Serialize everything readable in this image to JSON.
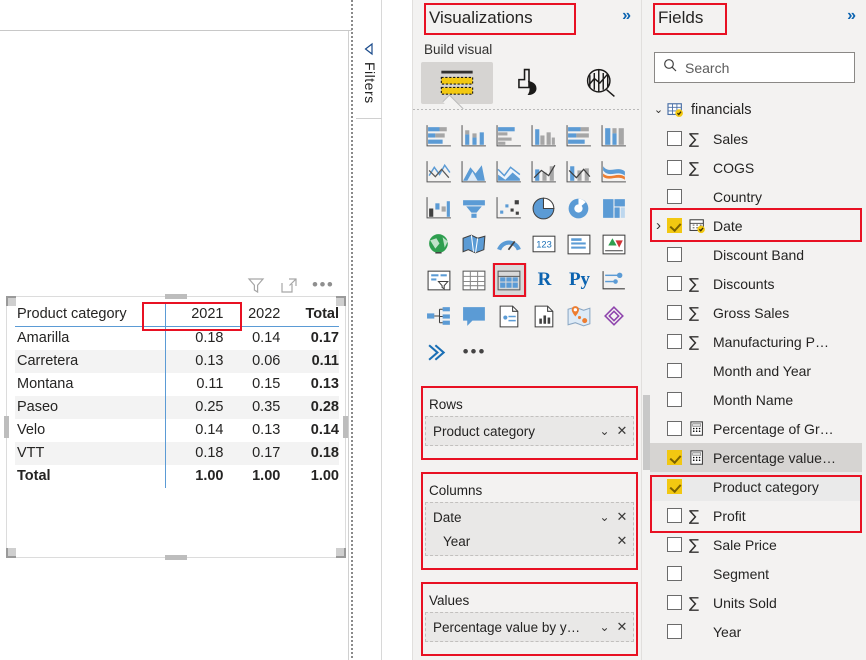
{
  "canvas": {
    "tab_chevron": "⌄",
    "filters_pane_label": "Filters"
  },
  "visual_header": {
    "filter_icon_name": "filter-icon",
    "focus_icon_name": "focus-mode-icon",
    "more_label": "•••"
  },
  "matrix": {
    "row_header": "Product category",
    "column_headers": [
      "2021",
      "2022"
    ],
    "total_header": "Total",
    "rows": [
      {
        "category": "Amarilla",
        "values": [
          "0.18",
          "0.14"
        ],
        "total": "0.17"
      },
      {
        "category": "Carretera",
        "values": [
          "0.13",
          "0.06"
        ],
        "total": "0.11"
      },
      {
        "category": "Montana",
        "values": [
          "0.11",
          "0.15"
        ],
        "total": "0.13"
      },
      {
        "category": "Paseo",
        "values": [
          "0.25",
          "0.35"
        ],
        "total": "0.28"
      },
      {
        "category": "Velo",
        "values": [
          "0.14",
          "0.13"
        ],
        "total": "0.14"
      },
      {
        "category": "VTT",
        "values": [
          "0.18",
          "0.17"
        ],
        "total": "0.18"
      }
    ],
    "total_row": {
      "category": "Total",
      "values": [
        "1.00",
        "1.00"
      ],
      "total": "1.00"
    }
  },
  "visualizations": {
    "title": "Visualizations",
    "expand_label": "»",
    "build_visual_label": "Build visual",
    "tabs": [
      {
        "name": "build-visual-tab",
        "active": true
      },
      {
        "name": "format-visual-tab",
        "active": false
      },
      {
        "name": "analytics-tab",
        "active": false
      }
    ],
    "gallery": {
      "selected": "matrix",
      "r_label": "R",
      "py_label": "Py",
      "more_label": "•••"
    },
    "wells": [
      {
        "title": "Rows",
        "name": "rows-well",
        "chips": [
          {
            "label": "Product category",
            "sub": false,
            "menu": "⌄",
            "remove": "✕"
          }
        ]
      },
      {
        "title": "Columns",
        "name": "columns-well",
        "chips": [
          {
            "label": "Date",
            "sub": false,
            "menu": "⌄",
            "remove": "✕"
          },
          {
            "label": "Year",
            "sub": true,
            "menu": "",
            "remove": "✕"
          }
        ]
      },
      {
        "title": "Values",
        "name": "values-well",
        "chips": [
          {
            "label": "Percentage value by y…",
            "sub": false,
            "menu": "⌄",
            "remove": "✕"
          }
        ]
      }
    ]
  },
  "fields": {
    "title": "Fields",
    "expand_label": "»",
    "search_placeholder": "Search",
    "table_name": "financials",
    "items": [
      {
        "label": "Sales",
        "checked": false,
        "icon": "sigma",
        "indent": 1,
        "expandable": false,
        "highlight": false
      },
      {
        "label": "COGS",
        "checked": false,
        "icon": "sigma",
        "indent": 1,
        "expandable": false,
        "highlight": false
      },
      {
        "label": "Country",
        "checked": false,
        "icon": "none",
        "indent": 1,
        "expandable": false,
        "highlight": false
      },
      {
        "label": "Date",
        "checked": true,
        "icon": "calendar",
        "indent": 0,
        "expandable": true,
        "highlight": false
      },
      {
        "label": "Discount Band",
        "checked": false,
        "icon": "none",
        "indent": 1,
        "expandable": false,
        "highlight": false
      },
      {
        "label": "Discounts",
        "checked": false,
        "icon": "sigma",
        "indent": 1,
        "expandable": false,
        "highlight": false
      },
      {
        "label": "Gross Sales",
        "checked": false,
        "icon": "sigma",
        "indent": 1,
        "expandable": false,
        "highlight": false
      },
      {
        "label": "Manufacturing P…",
        "checked": false,
        "icon": "sigma",
        "indent": 1,
        "expandable": false,
        "highlight": false
      },
      {
        "label": "Month and Year",
        "checked": false,
        "icon": "none",
        "indent": 1,
        "expandable": false,
        "highlight": false
      },
      {
        "label": "Month Name",
        "checked": false,
        "icon": "none",
        "indent": 1,
        "expandable": false,
        "highlight": false
      },
      {
        "label": "Percentage of Gr…",
        "checked": false,
        "icon": "measure",
        "indent": 1,
        "expandable": false,
        "highlight": false
      },
      {
        "label": "Percentage value…",
        "checked": true,
        "icon": "measure",
        "indent": 1,
        "expandable": false,
        "highlight": true
      },
      {
        "label": "Product category",
        "checked": true,
        "icon": "none",
        "indent": 1,
        "expandable": false,
        "highlight": true
      },
      {
        "label": "Profit",
        "checked": false,
        "icon": "sigma",
        "indent": 1,
        "expandable": false,
        "highlight": false
      },
      {
        "label": "Sale Price",
        "checked": false,
        "icon": "sigma",
        "indent": 1,
        "expandable": false,
        "highlight": false
      },
      {
        "label": "Segment",
        "checked": false,
        "icon": "none",
        "indent": 1,
        "expandable": false,
        "highlight": false
      },
      {
        "label": "Units Sold",
        "checked": false,
        "icon": "sigma",
        "indent": 1,
        "expandable": false,
        "highlight": false
      },
      {
        "label": "Year",
        "checked": false,
        "icon": "none",
        "indent": 1,
        "expandable": false,
        "highlight": false
      }
    ]
  },
  "colors": {
    "highlight_red": "#e81123",
    "powerbi_yellow": "#f2c811",
    "accent_blue": "#0b63b0",
    "matrix_rule_blue": "#5b9bd5",
    "pane_bg": "#f3f2f1"
  }
}
